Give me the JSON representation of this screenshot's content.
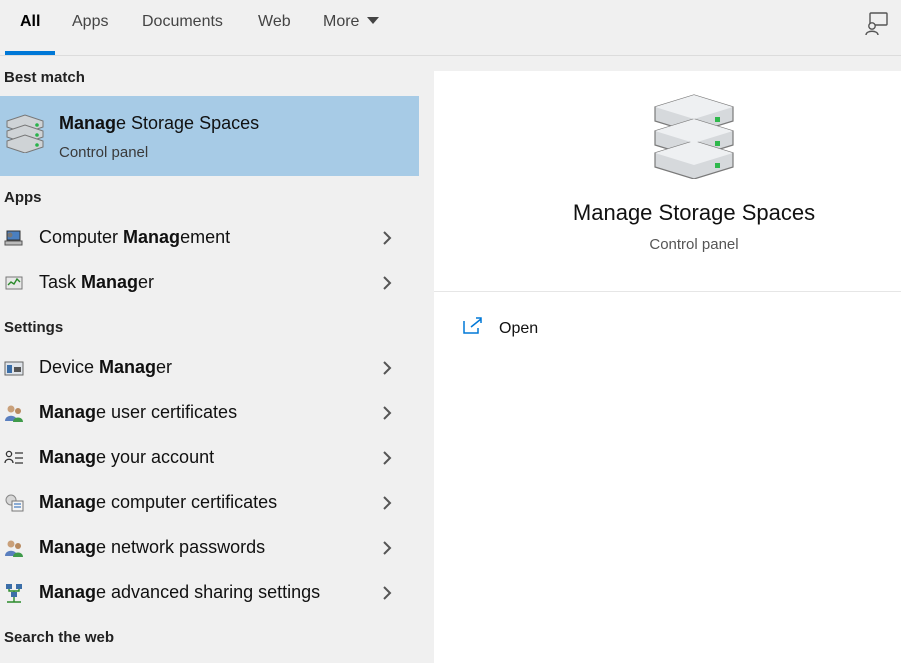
{
  "tabs": [
    {
      "label": "All",
      "active": true
    },
    {
      "label": "Apps",
      "active": false
    },
    {
      "label": "Documents",
      "active": false
    },
    {
      "label": "Web",
      "active": false
    },
    {
      "label": "More",
      "active": false
    }
  ],
  "sections": {
    "best_match": "Best match",
    "apps": "Apps",
    "settings": "Settings",
    "search_web": "Search the web"
  },
  "best_match": {
    "title_bold": "Manag",
    "title_rest": "e Storage Spaces",
    "subtitle": "Control panel",
    "icon": "storage-drives-icon"
  },
  "apps": [
    {
      "pre": "Computer ",
      "bold": "Manag",
      "post": "ement",
      "icon": "computer-management-icon"
    },
    {
      "pre": "Task ",
      "bold": "Manag",
      "post": "er",
      "icon": "task-manager-icon"
    }
  ],
  "settings": [
    {
      "pre": "Device ",
      "bold": "Manag",
      "post": "er",
      "icon": "device-manager-icon"
    },
    {
      "pre": "",
      "bold": "Manag",
      "post": "e user certificates",
      "icon": "users-icon"
    },
    {
      "pre": "",
      "bold": "Manag",
      "post": "e your account",
      "icon": "account-list-icon"
    },
    {
      "pre": "",
      "bold": "Manag",
      "post": "e computer certificates",
      "icon": "certificate-icon"
    },
    {
      "pre": "",
      "bold": "Manag",
      "post": "e network passwords",
      "icon": "users-icon"
    },
    {
      "pre": "",
      "bold": "Manag",
      "post": "e advanced sharing settings",
      "icon": "network-sharing-icon"
    }
  ],
  "preview": {
    "title": "Manage Storage Spaces",
    "subtitle": "Control panel",
    "actions": [
      {
        "label": "Open",
        "icon": "open-external-icon"
      }
    ]
  },
  "colors": {
    "accent": "#0078d7",
    "selected_bg": "#a7cbe6",
    "panel_bg": "#f0f0f0"
  }
}
